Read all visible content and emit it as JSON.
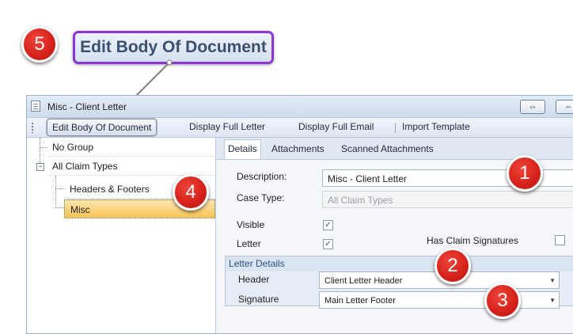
{
  "callouts": {
    "zoom_label": "Edit Body Of Document",
    "badges": [
      "1",
      "2",
      "3",
      "4",
      "5"
    ]
  },
  "window": {
    "title": "Misc  - Client Letter",
    "buttons": {
      "swap_icon": "⇔",
      "minimize_icon": "–"
    }
  },
  "toolbar": {
    "edit_body": "Edit Body Of Document",
    "display_letter": "Display Full Letter",
    "display_email": "Display Full Email",
    "import_template": "Import Template"
  },
  "tree": {
    "no_group": "No Group",
    "expander": "−",
    "all_claim_types": "All Claim Types",
    "headers_footers": "Headers & Footers",
    "misc": "Misc"
  },
  "tabs": [
    "Details",
    "Attachments",
    "Scanned Attachments"
  ],
  "form": {
    "description_label": "Description:",
    "description_value": "Misc  - Client Letter",
    "case_type_label": "Case Type:",
    "case_type_value": "All Claim Types",
    "visible_label": "Visible",
    "visible_checked": "✓",
    "letter_label": "Letter",
    "letter_checked": "✓",
    "has_claim_signatures_label": "Has Claim Signatures",
    "has_claim_signatures_checked": "",
    "letter_details_title": "Letter Details",
    "header_label": "Header",
    "header_value": "Client Letter Header",
    "signature_label": "Signature",
    "signature_value": "Main Letter Footer",
    "caret": "▼"
  },
  "colors": {
    "badge_red": "#d4211a",
    "callout_border": "#8b35d6",
    "selection": "#f9c455",
    "group_title": "#2b4f8a"
  }
}
